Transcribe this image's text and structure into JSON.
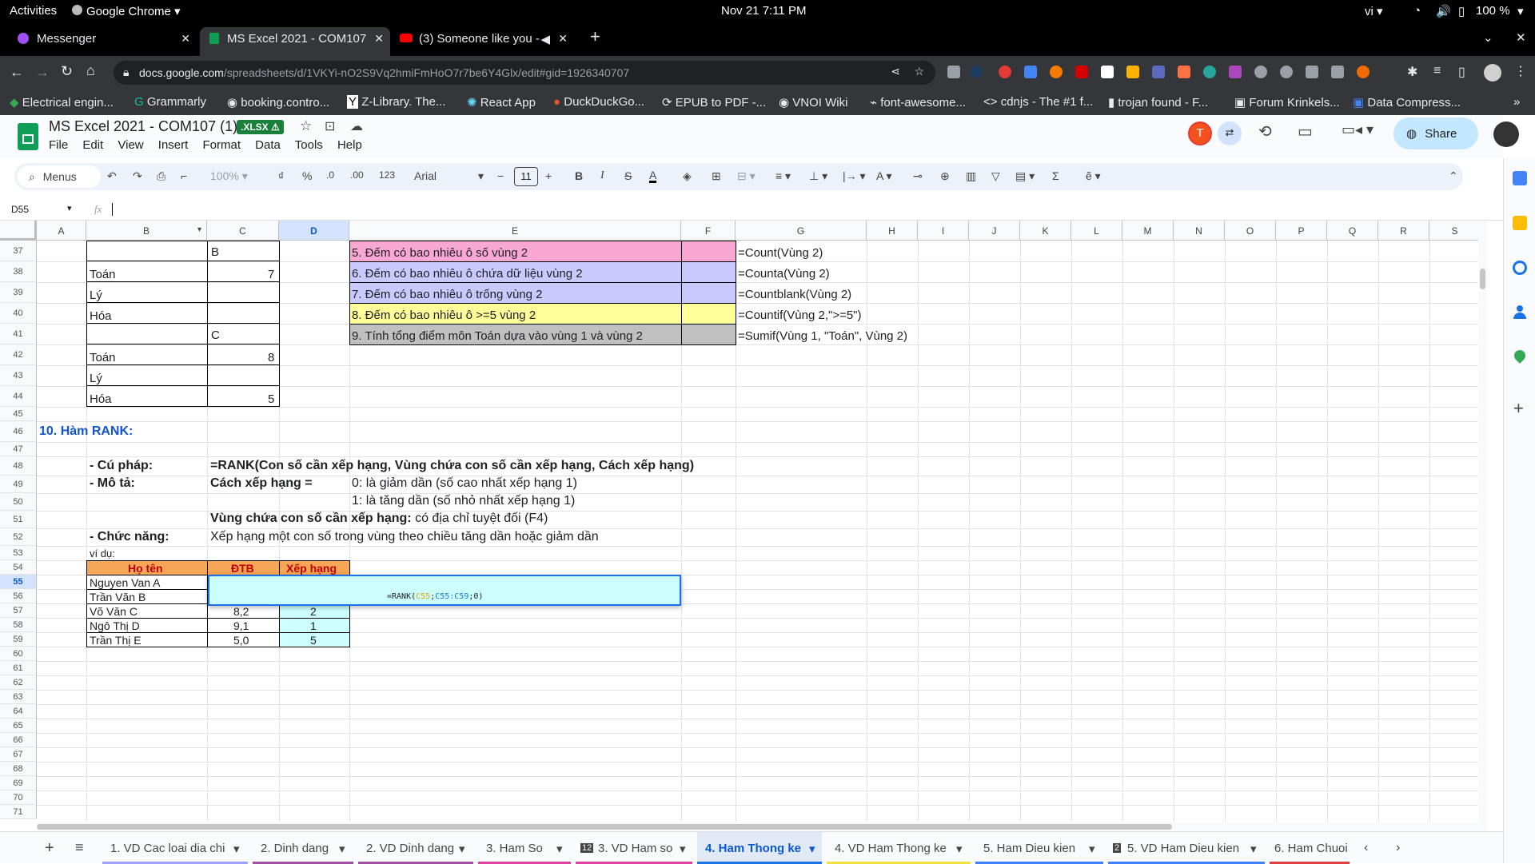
{
  "os_bar": {
    "activities": "Activities",
    "app": "Google Chrome",
    "datetime": "Nov 21  7:11 PM",
    "lang": "vi",
    "battery": "100 %"
  },
  "browser": {
    "tabs": [
      {
        "title": "Messenger"
      },
      {
        "title": "MS Excel 2021 - COM107"
      },
      {
        "title": "(3) Someone like you -"
      }
    ],
    "url_host": "docs.google.com",
    "url_path": "/spreadsheets/d/1VKYi-nO2S9Vq2hmiFmHoO7r7be6Y4Glx/edit#gid=1926340707",
    "bookmarks": [
      "Electrical engin...",
      "Grammarly",
      "booking.contro...",
      "Z-Library. The...",
      "React App",
      "DuckDuckGo...",
      "EPUB to PDF -...",
      "VNOI Wiki",
      "font-awesome...",
      "cdnjs - The #1 f...",
      "trojan found - F...",
      "Forum Krinkels...",
      "Data Compress..."
    ]
  },
  "doc": {
    "title": "MS Excel 2021 - COM107 (1)",
    "badge": ".XLSX",
    "menus": [
      "File",
      "Edit",
      "View",
      "Insert",
      "Format",
      "Data",
      "Tools",
      "Help"
    ],
    "avatar": "T",
    "share": "Share"
  },
  "toolbar": {
    "search": "Menus",
    "zoom": "100%",
    "font": "Arial",
    "size": "11",
    "currency": "₫",
    "percent": "%",
    "dec_less": ".0",
    "dec_more": ".00",
    "num": "123"
  },
  "formula_bar": {
    "name_box": "D55",
    "fx": "fx"
  },
  "columns": [
    "A",
    "B",
    "C",
    "D",
    "E",
    "F",
    "G",
    "H",
    "I",
    "J",
    "K",
    "L",
    "M",
    "N",
    "O",
    "P",
    "Q",
    "R",
    "S"
  ],
  "rows": [
    "37",
    "38",
    "39",
    "40",
    "41",
    "42",
    "43",
    "44",
    "45",
    "46",
    "47",
    "48",
    "49",
    "50",
    "51",
    "52",
    "53",
    "54",
    "55",
    "56",
    "57",
    "58",
    "59",
    "60",
    "61",
    "62",
    "63",
    "64",
    "65",
    "66",
    "67",
    "68",
    "69",
    "70",
    "71"
  ],
  "cells": {
    "c37": "B",
    "b38": "Toán",
    "c38": "7",
    "b39": "Lý",
    "b40": "Hóa",
    "c41": "C",
    "b42": "Toán",
    "c42": "8",
    "b43": "Lý",
    "b44": "Hóa",
    "c44": "5",
    "e37": "5. Đếm có bao nhiêu ô số vùng 2",
    "e38": "6. Đếm có bao nhiêu ô chứa dữ liệu vùng 2",
    "e39": "7. Đếm có bao nhiêu ô trống vùng 2",
    "e40": "8. Đếm có bao nhiêu ô >=5 vùng 2",
    "e41": "9. Tính tổng điểm môn Toán dựa vào vùng 1 và vùng 2",
    "g37": "=Count(Vùng 2)",
    "g38": "=Counta(Vùng 2)",
    "g39": "=Countblank(Vùng 2)",
    "g40": "=Countif(Vùng 2,\">=5\")",
    "g41": "=Sumif(Vùng 1, \"Toán\", Vùng 2)",
    "a46": "10. Hàm RANK:",
    "b48": "- Cú pháp:",
    "c48": "=RANK(Con số cần xếp hạng, Vùng chứa con số cần xếp hạng, Cách xếp hạng)",
    "b49": "- Mô tả:",
    "c49": "Cách xếp hạng =",
    "d49": "0: là giảm dần (số cao nhất xếp hạng 1)",
    "d50": "1: là tăng dần (số nhỏ nhất xếp hạng 1)",
    "c51_bold": "Vùng chứa con số cần xếp hạng:",
    "c51_rest": " có địa chỉ tuyệt đối (F4)",
    "b52": "- Chức năng:",
    "c52": "Xếp hạng một con số trong vùng theo chiều tăng dần hoặc giảm dần",
    "b53": "ví dụ:",
    "h_name": "Họ tên",
    "h_dtb": "ĐTB",
    "h_rank": "Xếp hạng",
    "students": [
      {
        "name": "Nguyen Van A",
        "dtb": "",
        "rank": ""
      },
      {
        "name": "Trần Văn B",
        "dtb": "",
        "rank": ""
      },
      {
        "name": "Võ Văn C",
        "dtb": "8,2",
        "rank": "2"
      },
      {
        "name": "Ngô Thị D",
        "dtb": "9,1",
        "rank": "1"
      },
      {
        "name": "Trần Thị E",
        "dtb": "5,0",
        "rank": "5"
      }
    ],
    "edit_formula_a": "=RANK(",
    "edit_formula_b": "C55",
    "edit_formula_c": ";",
    "edit_formula_d": "C55:C59",
    "edit_formula_e": ";0)"
  },
  "sheet_tabs": [
    "1. VD Cac loai dia chi",
    "2. Dinh dang",
    "2. VD Dinh dang",
    "3. Ham So",
    "3. VD Ham so",
    "4. Ham Thong ke",
    "4. VD Ham Thong ke",
    "5. Ham Dieu kien",
    "5. VD Ham Dieu kien",
    "6. Ham Chuoi"
  ],
  "colors": {
    "pink": "#f9a8d4",
    "lavender": "#c9c9ff",
    "yellow": "#ffff99",
    "gray": "#c0c0c0",
    "orange": "#f5a656",
    "cyan": "#ccffff",
    "accent": "#1a73e8",
    "title_blue": "#1155cc"
  }
}
